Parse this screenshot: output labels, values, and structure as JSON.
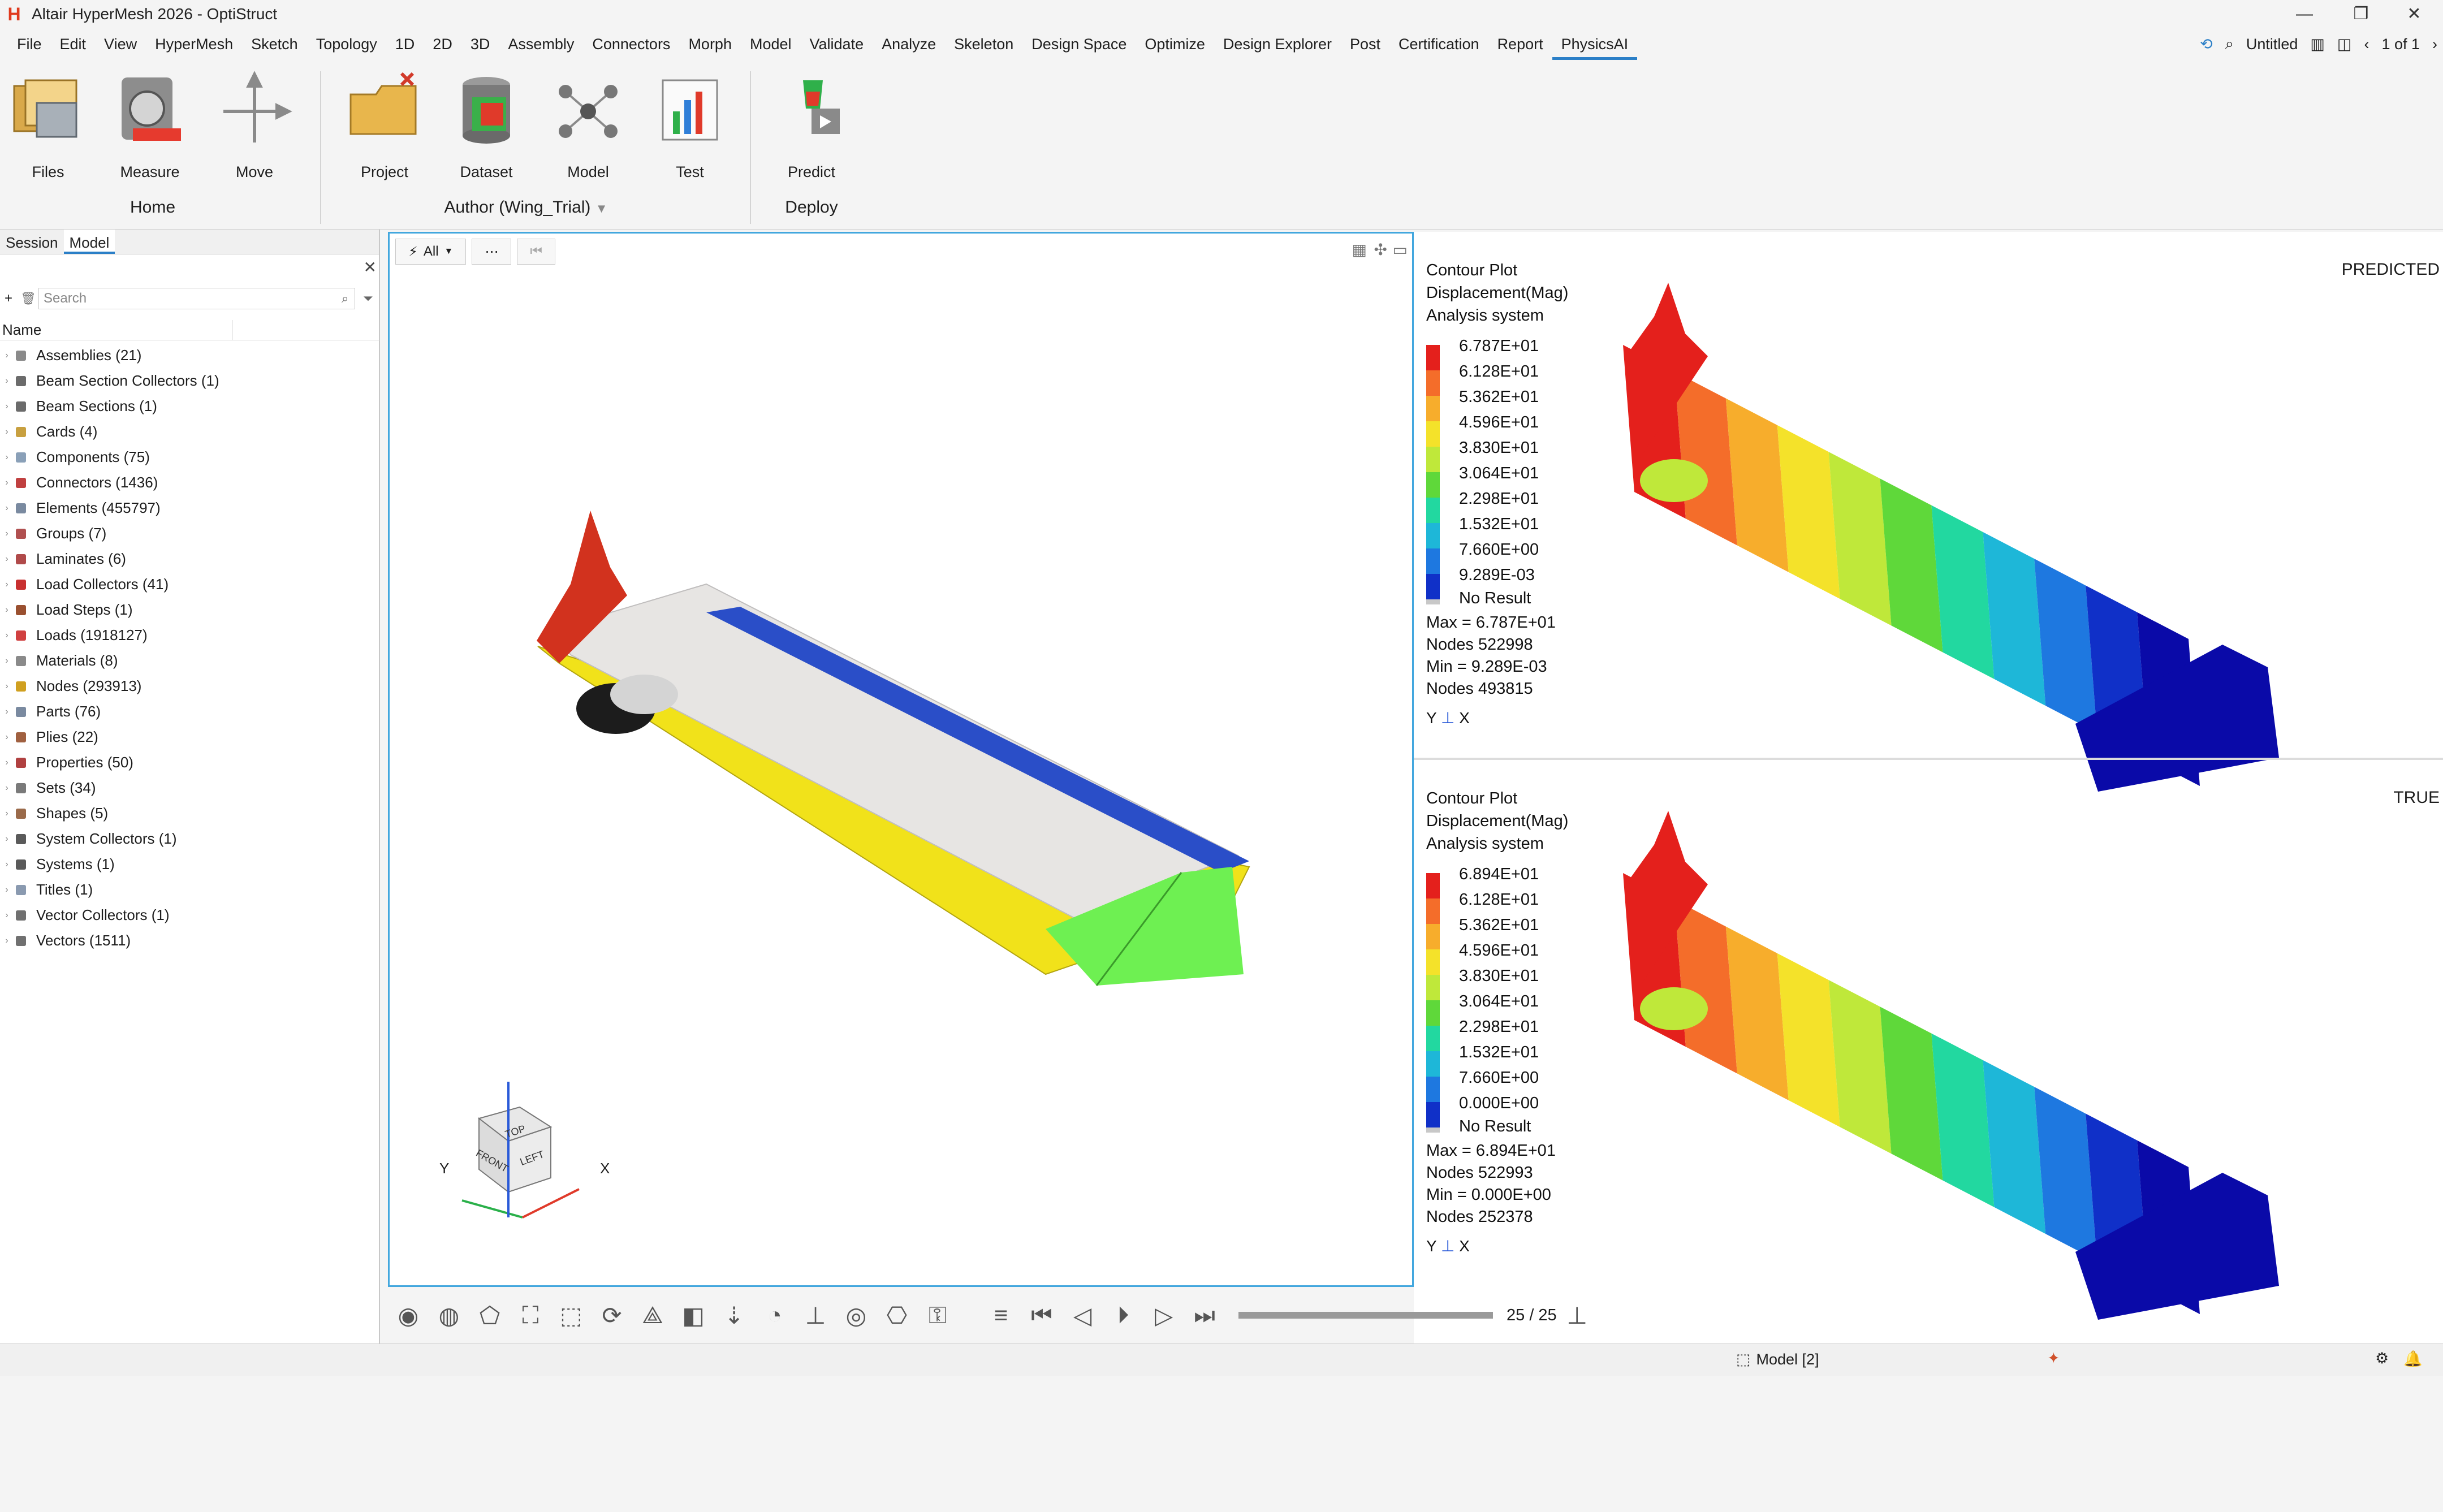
{
  "title": "Altair HyperMesh 2026 - OptiStruct",
  "menu": [
    "File",
    "Edit",
    "View",
    "HyperMesh",
    "Sketch",
    "Topology",
    "1D",
    "2D",
    "3D",
    "Assembly",
    "Connectors",
    "Morph",
    "Model",
    "Validate",
    "Analyze",
    "Skeleton",
    "Design Space",
    "Optimize",
    "Design Explorer",
    "Post",
    "Certification",
    "Report",
    "PhysicsAI"
  ],
  "menu_active": "PhysicsAI",
  "menu_right": {
    "doc": "Untitled",
    "pages": "1 of 1"
  },
  "ribbon": {
    "buttons": [
      "Files",
      "Measure",
      "Move",
      "Project",
      "Dataset",
      "Model",
      "Test",
      "Predict"
    ],
    "groups": {
      "home": "Home",
      "author": "Author (Wing_Trial)",
      "deploy": "Deploy"
    }
  },
  "panel": {
    "tabs": [
      "Session",
      "Model"
    ],
    "search_placeholder": "Search",
    "column": "Name",
    "items": [
      {
        "label": "Assemblies (21)",
        "color": "#8a8a8a"
      },
      {
        "label": "Beam Section Collectors (1)",
        "color": "#6b6b6b"
      },
      {
        "label": "Beam Sections (1)",
        "color": "#6b6b6b"
      },
      {
        "label": "Cards (4)",
        "color": "#c8a040"
      },
      {
        "label": "Components (75)",
        "color": "#8aa0b8"
      },
      {
        "label": "Connectors (1436)",
        "color": "#c04040"
      },
      {
        "label": "Elements (455797)",
        "color": "#7a8aa0"
      },
      {
        "label": "Groups (7)",
        "color": "#b05050"
      },
      {
        "label": "Laminates (6)",
        "color": "#b04a4a"
      },
      {
        "label": "Load Collectors (41)",
        "color": "#c83030"
      },
      {
        "label": "Load Steps (1)",
        "color": "#9a5030"
      },
      {
        "label": "Loads (1918127)",
        "color": "#d04040"
      },
      {
        "label": "Materials (8)",
        "color": "#8a8a8a"
      },
      {
        "label": "Nodes (293913)",
        "color": "#d0a020"
      },
      {
        "label": "Parts (76)",
        "color": "#7a8aa0"
      },
      {
        "label": "Plies (22)",
        "color": "#a06040"
      },
      {
        "label": "Properties (50)",
        "color": "#b04040"
      },
      {
        "label": "Sets (34)",
        "color": "#7a7a7a"
      },
      {
        "label": "Shapes (5)",
        "color": "#9a6a4a"
      },
      {
        "label": "System Collectors (1)",
        "color": "#5a5a5a"
      },
      {
        "label": "Systems (1)",
        "color": "#5a5a5a"
      },
      {
        "label": "Titles (1)",
        "color": "#8a9ab0"
      },
      {
        "label": "Vector Collectors (1)",
        "color": "#707070"
      },
      {
        "label": "Vectors (1511)",
        "color": "#707070"
      }
    ]
  },
  "viewport": {
    "filter": "All",
    "axis_y": "Y",
    "axis_x": "X",
    "cube": {
      "top": "TOP",
      "front": "FRONT",
      "left": "LEFT"
    }
  },
  "results": {
    "predicted": {
      "tag": "PREDICTED",
      "lines": [
        "Contour Plot",
        "Displacement(Mag)",
        "Analysis system"
      ],
      "values": [
        "6.787E+01",
        "6.128E+01",
        "5.362E+01",
        "4.596E+01",
        "3.830E+01",
        "3.064E+01",
        "2.298E+01",
        "1.532E+01",
        "7.660E+00",
        "9.289E-03"
      ],
      "no_result": "No Result",
      "stats": [
        "Max = 6.787E+01",
        "Nodes 522998",
        "Min = 9.289E-03",
        "Nodes 493815"
      ]
    },
    "true": {
      "tag": "TRUE",
      "lines": [
        "Contour Plot",
        "Displacement(Mag)",
        "Analysis system"
      ],
      "values": [
        "6.894E+01",
        "6.128E+01",
        "5.362E+01",
        "4.596E+01",
        "3.830E+01",
        "3.064E+01",
        "2.298E+01",
        "1.532E+01",
        "7.660E+00",
        "0.000E+00"
      ],
      "no_result": "No Result",
      "stats": [
        "Max = 6.894E+01",
        "Nodes 522993",
        "Min = 0.000E+00",
        "Nodes 252378"
      ]
    },
    "scale_colors": [
      "#e4201c",
      "#f46d2a",
      "#f7ad2c",
      "#f4e22a",
      "#bfe83a",
      "#5fd83a",
      "#22d8a0",
      "#1eb7d8",
      "#1e78e0",
      "#1030c8",
      "#0a0aa8"
    ]
  },
  "animation": {
    "frame": "25 / 25",
    "progress": 1.0
  },
  "status": {
    "model": "Model [2]"
  }
}
